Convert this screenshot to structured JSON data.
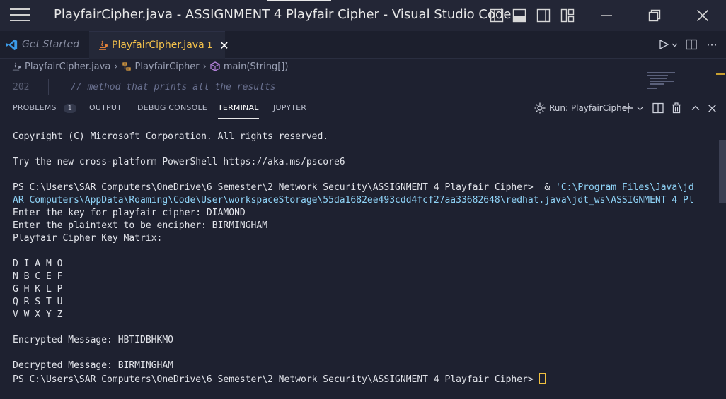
{
  "window": {
    "title": "PlayfairCipher.java - ASSIGNMENT 4 Playfair Cipher - Visual Studio Code"
  },
  "tabs": [
    {
      "label": "Get Started",
      "active": false
    },
    {
      "label": "PlayfairCipher.java",
      "badge": "1",
      "active": true
    }
  ],
  "breadcrumb": {
    "file": "PlayfairCipher.java",
    "class": "PlayfairCipher",
    "method": "main(String[])"
  },
  "editor": {
    "line_number": "202",
    "code": "// method that prints all the results"
  },
  "panel": {
    "tabs": [
      {
        "label": "PROBLEMS",
        "count": "1"
      },
      {
        "label": "OUTPUT"
      },
      {
        "label": "DEBUG CONSOLE"
      },
      {
        "label": "TERMINAL",
        "active": true
      },
      {
        "label": "JUPYTER"
      }
    ],
    "run_label": "Run: PlayfairCipher"
  },
  "terminal": {
    "copyright": "Copyright (C) Microsoft Corporation. All rights reserved.",
    "try_msg": "Try the new cross-platform PowerShell https://aka.ms/pscore6",
    "prompt": "PS C:\\Users\\SAR Computers\\OneDrive\\6 Semester\\2 Network Security\\ASSIGNMENT 4 Playfair Cipher>  & ",
    "cmd_part1": "'C:\\Program Files\\Java\\jd",
    "cmd_part2": "AR Computers\\AppData\\Roaming\\Code\\User\\workspaceStorage\\55da1682ee493cdd4fcf27aa33682648\\redhat.java\\jdt_ws\\ASSIGNMENT 4 Pl",
    "key_prompt": "Enter the key for playfair cipher: DIAMOND",
    "plain_prompt": "Enter the plaintext to be encipher: BIRMINGHAM",
    "matrix_title": "Playfair Cipher Key Matrix:",
    "matrix": [
      "D I A M O",
      "N B C E F",
      "G H K L P",
      "Q R S T U",
      "V W X Y Z"
    ],
    "encrypted": "Encrypted Message: HBTIDBHKMO",
    "decrypted": "Decrypted Message: BIRMINGHAM",
    "final_prompt": "PS C:\\Users\\SAR Computers\\OneDrive\\6 Semester\\2 Network Security\\ASSIGNMENT 4 Playfair Cipher> "
  },
  "colors": {
    "accent_tab": "#f3c14b",
    "terminal_bg": "#1e2130",
    "command_text": "#8fd3f7",
    "vscode_blue": "#3b9ae8",
    "java_orange": "#e0803a"
  }
}
